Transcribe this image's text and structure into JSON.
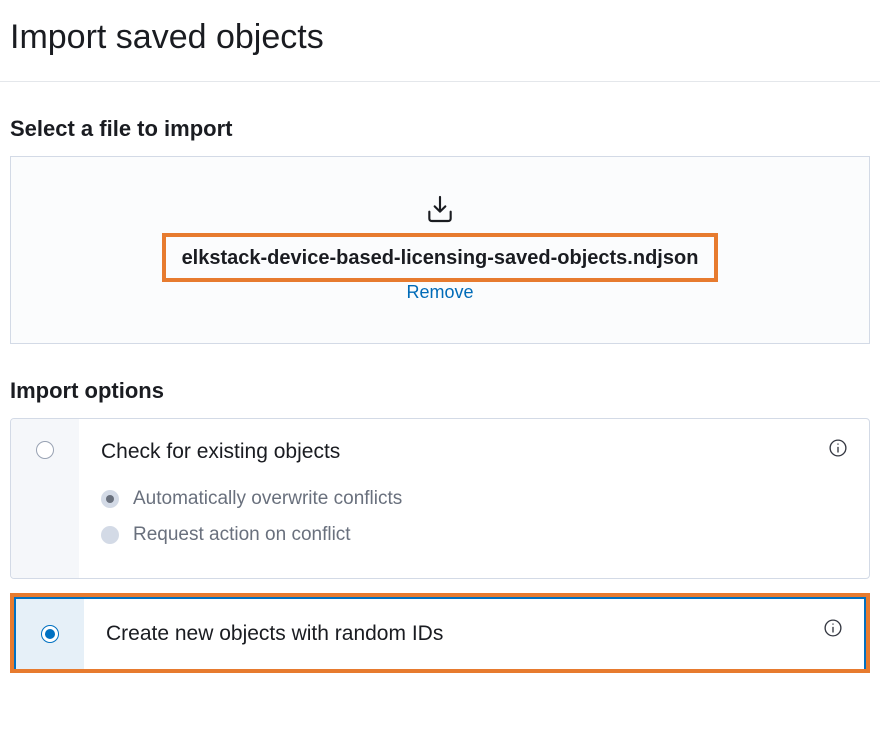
{
  "title": "Import saved objects",
  "file_section": {
    "heading": "Select a file to import",
    "filename": "elkstack-device-based-licensing-saved-objects.ndjson",
    "remove_label": "Remove"
  },
  "options_section": {
    "heading": "Import options",
    "option_check": {
      "title": "Check for existing objects",
      "sub_overwrite": "Automatically overwrite conflicts",
      "sub_request": "Request action on conflict"
    },
    "option_create": {
      "title": "Create new objects with random IDs"
    }
  }
}
